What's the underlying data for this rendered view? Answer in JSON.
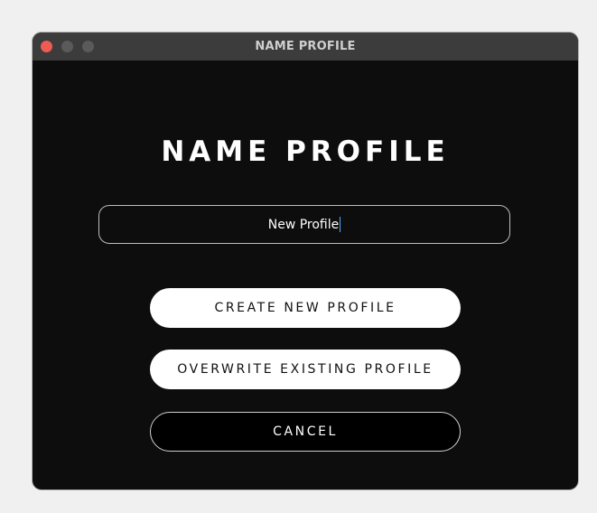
{
  "window": {
    "title": "NAME PROFILE"
  },
  "dialog": {
    "heading": "NAME PROFILE",
    "name_input": {
      "value": "New Profile"
    },
    "buttons": {
      "create": "CREATE NEW PROFILE",
      "overwrite": "OVERWRITE EXISTING PROFILE",
      "cancel": "CANCEL"
    }
  },
  "colors": {
    "background": "#0d0d0d",
    "titlebar": "#3c3c3c",
    "close_dot": "#ee5b52",
    "caret": "#58a6ff"
  }
}
